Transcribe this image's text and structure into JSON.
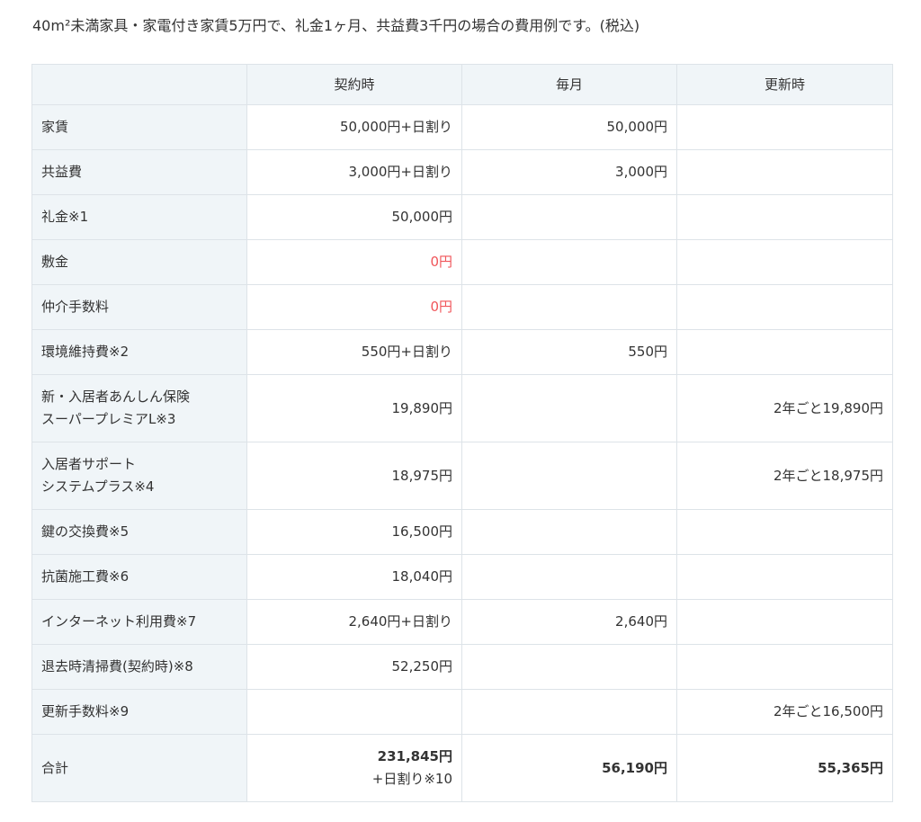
{
  "intro": "40m²未満家具・家電付き家賃5万円で、礼金1ヶ月、共益費3千円の場合の費用例です。(税込)",
  "table": {
    "headers": [
      "",
      "契約時",
      "毎月",
      "更新時"
    ],
    "rows": [
      {
        "label": [
          "家賃"
        ],
        "contract": "50,000円+日割り",
        "monthly": "50,000円",
        "renewal": ""
      },
      {
        "label": [
          "共益費"
        ],
        "contract": "3,000円+日割り",
        "monthly": "3,000円",
        "renewal": ""
      },
      {
        "label": [
          "礼金※1"
        ],
        "contract": "50,000円",
        "monthly": "",
        "renewal": ""
      },
      {
        "label": [
          "敷金"
        ],
        "contract": "0円",
        "monthly": "",
        "renewal": ""
      },
      {
        "label": [
          "仲介手数料"
        ],
        "contract": "0円",
        "monthly": "",
        "renewal": ""
      },
      {
        "label": [
          "環境維持費※2"
        ],
        "contract": "550円+日割り",
        "monthly": "550円",
        "renewal": ""
      },
      {
        "label": [
          "新・入居者あんしん保険",
          "スーパープレミアL※3"
        ],
        "contract": "19,890円",
        "monthly": "",
        "renewal": "2年ごと19,890円"
      },
      {
        "label": [
          "入居者サポート",
          "システムプラス※4"
        ],
        "contract": "18,975円",
        "monthly": "",
        "renewal": "2年ごと18,975円"
      },
      {
        "label": [
          "鍵の交換費※5"
        ],
        "contract": "16,500円",
        "monthly": "",
        "renewal": ""
      },
      {
        "label": [
          "抗菌施工費※6"
        ],
        "contract": "18,040円",
        "monthly": "",
        "renewal": ""
      },
      {
        "label": [
          "インターネット利用費※7"
        ],
        "contract": "2,640円+日割り",
        "monthly": "2,640円",
        "renewal": ""
      },
      {
        "label": [
          "退去時清掃費(契約時)※8"
        ],
        "contract": "52,250円",
        "monthly": "",
        "renewal": ""
      },
      {
        "label": [
          "更新手数料※9"
        ],
        "contract": "",
        "monthly": "",
        "renewal": "2年ごと16,500円"
      }
    ],
    "total": {
      "label": "合計",
      "contract": "231,845円",
      "contract_note": "+日割り※10",
      "monthly": "56,190円",
      "renewal": "55,365円"
    }
  },
  "colors": {
    "header_bg": "#f0f5f8",
    "border": "#dde3e8",
    "text": "#333333",
    "zero_highlight": "#f0555a"
  }
}
